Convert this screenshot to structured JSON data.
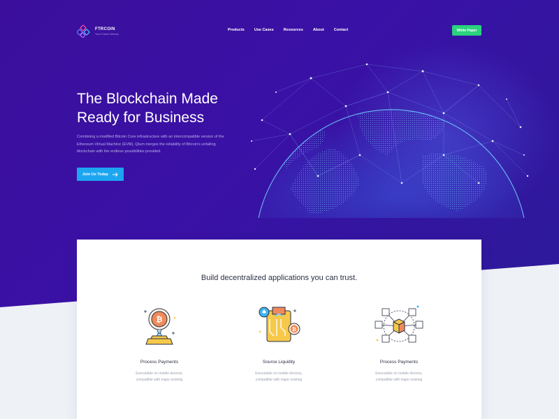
{
  "brand": {
    "name": "FTRCOIN",
    "tagline": "Your Future Money"
  },
  "nav": {
    "items": [
      "Products",
      "Use Cases",
      "Resources",
      "About",
      "Contact"
    ],
    "cta_label": "White Paper"
  },
  "hero": {
    "title_line1": "The Blockchain Made",
    "title_line2": "Ready for Business",
    "description": "Combining a modified Bitcoin Core infrastructure with an intercompatible version of the Ethereum Virtual Machine (EVM), Qtum merges the reliability of Bitcoin's unfailing blockchain with the endless possibilities provided.",
    "cta_label": "Join Us Today",
    "cta_icon": "arrow-right-icon"
  },
  "features": {
    "heading": "Build decentralized applications you can trust.",
    "items": [
      {
        "title": "Process Payments",
        "description": "Executable on mobile devices, compatible with major existing",
        "icon": "bitcoin-coin-icon"
      },
      {
        "title": "Source Liquidity",
        "description": "Executable on mobile devices, compatible with major existing",
        "icon": "wallet-crypto-icon"
      },
      {
        "title": "Process Payments",
        "description": "Executable on mobile devices, compatible with major existing",
        "icon": "blockchain-cubes-icon"
      }
    ]
  },
  "colors": {
    "hero_bg": "#3b0f9c",
    "accent_green": "#2ad37e",
    "accent_blue": "#1da6f0",
    "text_dark": "#2b2f45",
    "text_muted": "#9aa0b0"
  }
}
